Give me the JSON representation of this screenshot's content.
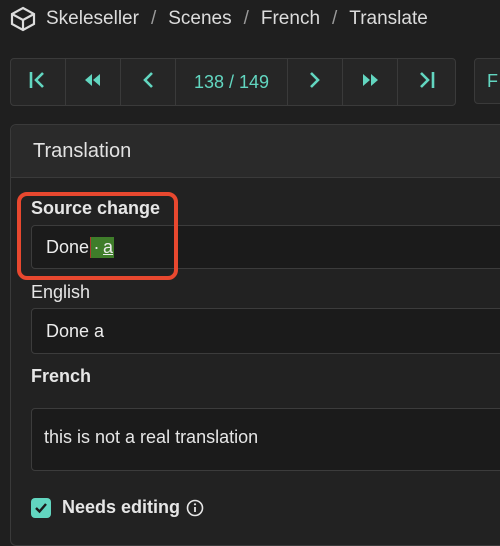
{
  "breadcrumb": {
    "items": [
      "Skeleseller",
      "Scenes",
      "French",
      "Translate"
    ],
    "separator": "/"
  },
  "pager": {
    "counter": "138 / 149",
    "extra_label": "F",
    "buttons": [
      "first-icon",
      "fast-back-icon",
      "prev-icon",
      "next-icon",
      "fast-forward-icon",
      "last-icon"
    ]
  },
  "translation": {
    "title": "Translation",
    "source_change": {
      "label": "Source change",
      "text_before": "Done",
      "inserted_space": "·",
      "inserted_text": "a"
    },
    "english": {
      "label": "English",
      "value": "Done a"
    },
    "french": {
      "label": "French",
      "value": "this is not a real translation"
    },
    "needs_editing": {
      "label": "Needs editing",
      "checked": true
    }
  },
  "colors": {
    "accent": "#62d6c0",
    "highlight": "#e8482f",
    "insert_bg": "#3f7d2a",
    "background": "#1f1f1f"
  }
}
